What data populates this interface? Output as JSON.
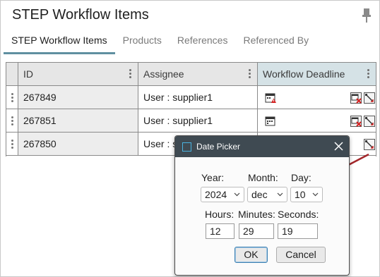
{
  "title": "STEP Workflow Items",
  "tabs": [
    {
      "label": "STEP Workflow Items",
      "active": true
    },
    {
      "label": "Products",
      "active": false
    },
    {
      "label": "References",
      "active": false
    },
    {
      "label": "Referenced By",
      "active": false
    }
  ],
  "grid": {
    "columns": [
      "ID",
      "Assignee",
      "Workflow Deadline"
    ],
    "rows": [
      {
        "id": "267849",
        "assignee": "User : supplier1",
        "deadline_icon": "calendar-warning-icon"
      },
      {
        "id": "267851",
        "assignee": "User : supplier1",
        "deadline_icon": "calendar-icon"
      },
      {
        "id": "267850",
        "assignee": "User : s",
        "deadline_icon": ""
      }
    ]
  },
  "dialog": {
    "title": "Date Picker",
    "year_label": "Year:",
    "month_label": "Month:",
    "day_label": "Day:",
    "year": "2024",
    "month": "dec",
    "day": "10",
    "hours_label": "Hours:",
    "minutes_label": "Minutes:",
    "seconds_label": "Seconds:",
    "hours": "12",
    "minutes": "29",
    "seconds": "19",
    "ok": "OK",
    "cancel": "Cancel"
  },
  "colors": {
    "tab_underline": "#5f8fa0",
    "header_highlight": "#d5e2e6",
    "dialog_title_bg": "#3f4a52",
    "arrow": "#a3262a"
  }
}
